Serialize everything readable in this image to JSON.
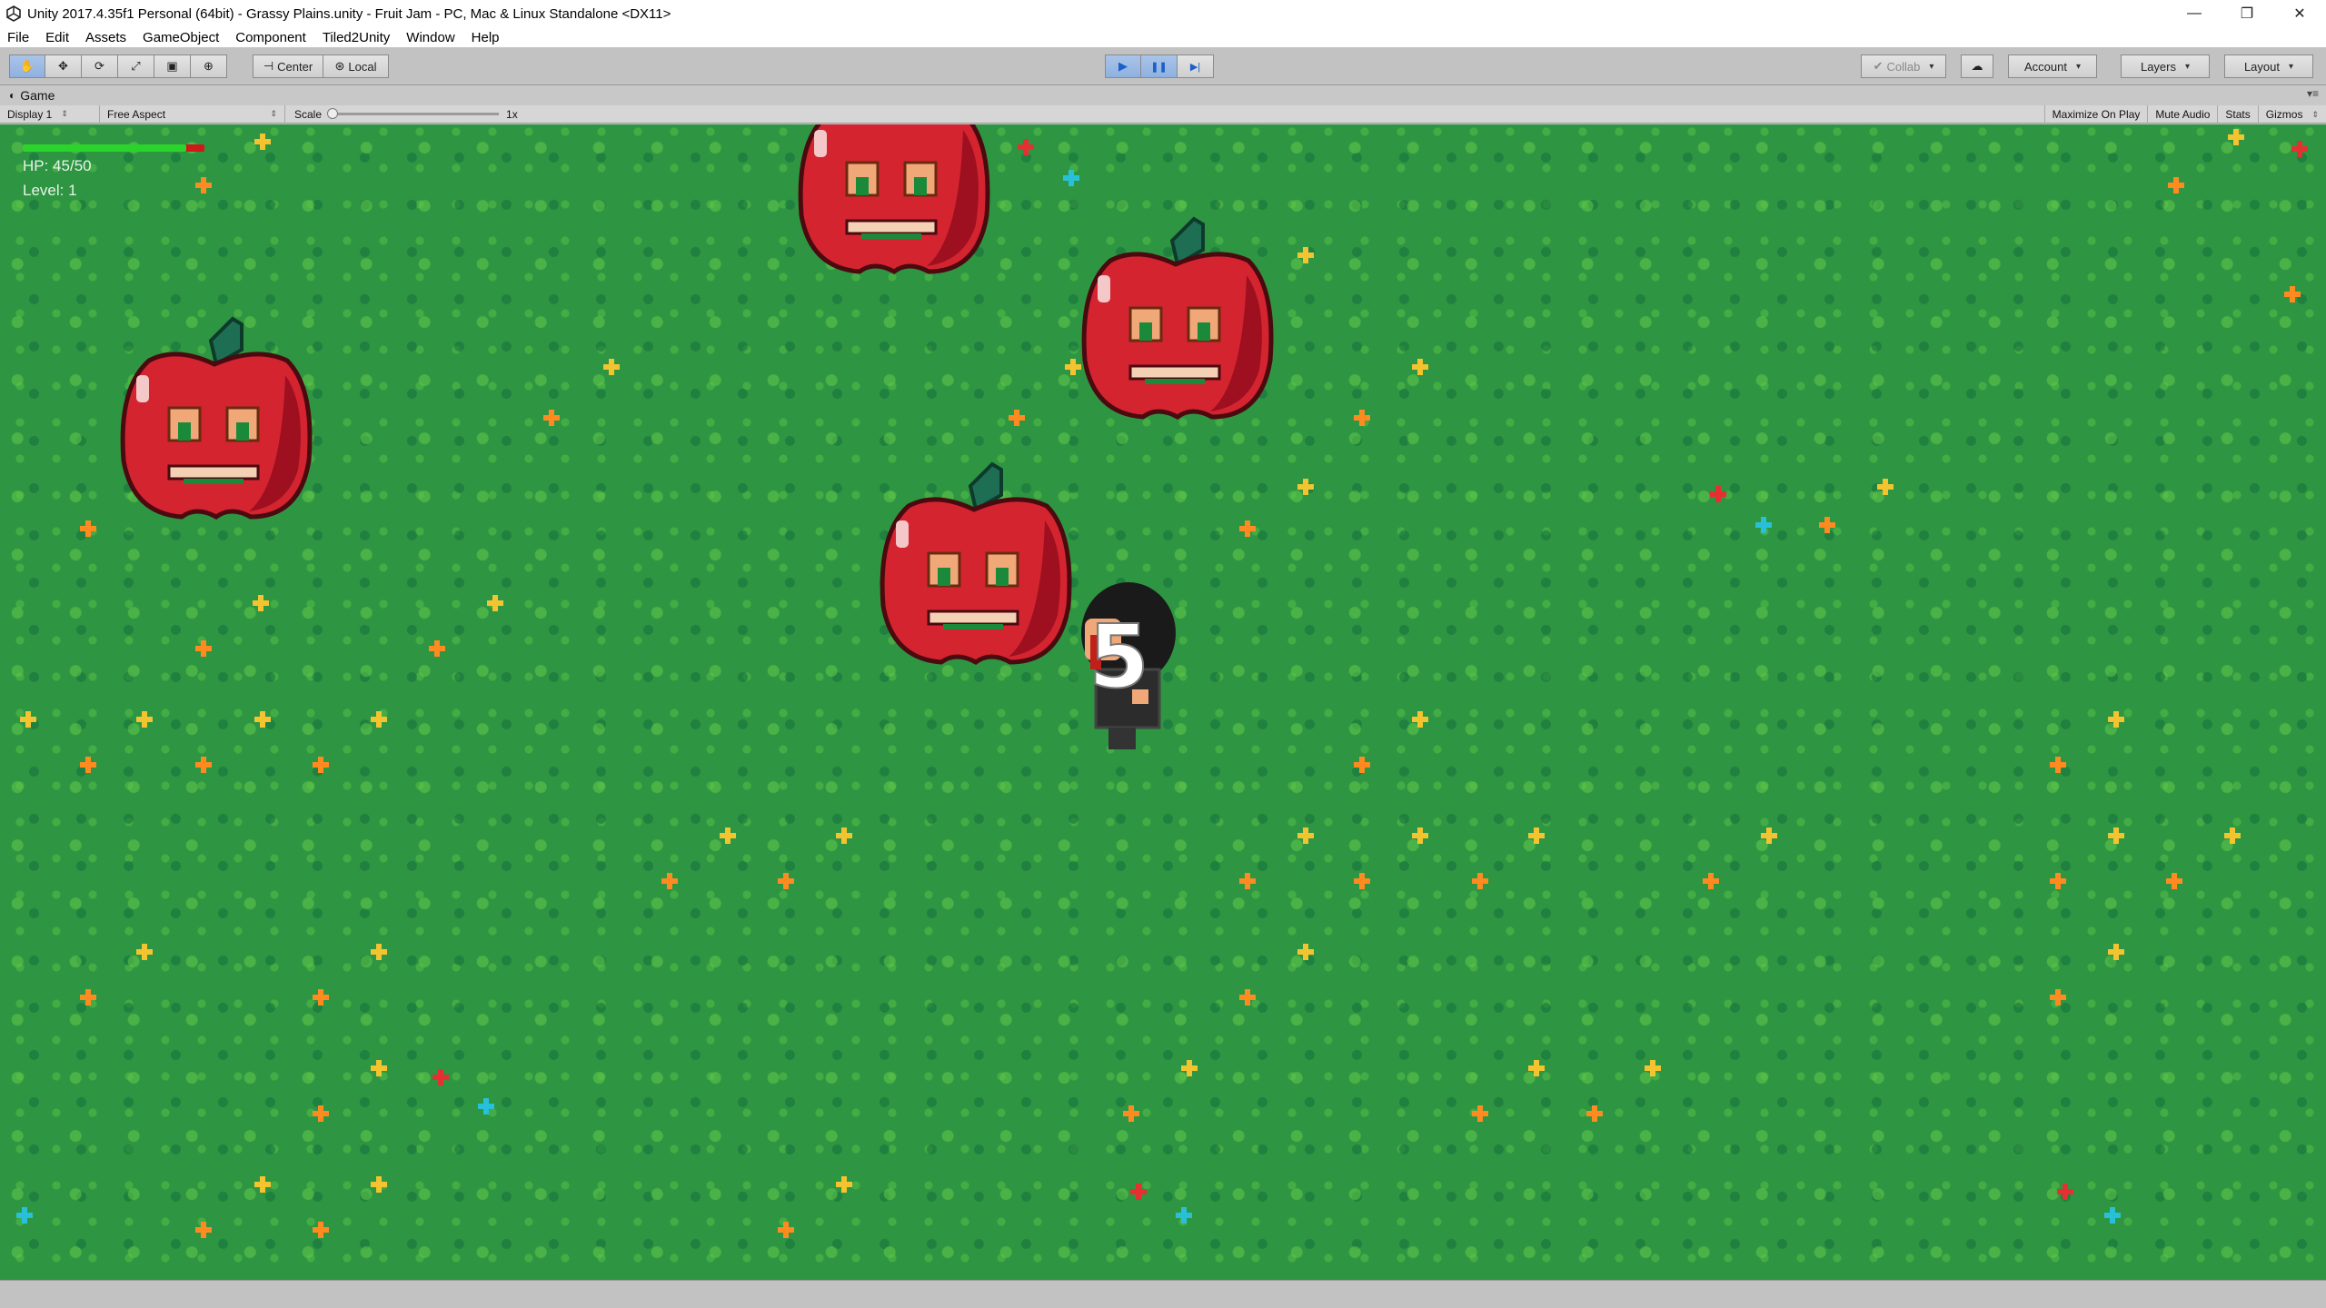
{
  "window": {
    "title": "Unity 2017.4.35f1 Personal (64bit) - Grassy Plains.unity - Fruit Jam - PC, Mac & Linux Standalone <DX11>",
    "controls": {
      "minimize": "—",
      "restore": "❐",
      "close": "✕"
    }
  },
  "menu": [
    "File",
    "Edit",
    "Assets",
    "GameObject",
    "Component",
    "Tiled2Unity",
    "Window",
    "Help"
  ],
  "toolbar": {
    "tools": [
      {
        "icon": "✋",
        "name": "hand-tool-button"
      },
      {
        "icon": "✥",
        "name": "move-tool-button"
      },
      {
        "icon": "⟳",
        "name": "rotate-tool-button"
      },
      {
        "icon": "⤢",
        "name": "scale-tool-button"
      },
      {
        "icon": "▣",
        "name": "rect-tool-button"
      },
      {
        "icon": "⊕",
        "name": "transform-tool-button"
      }
    ],
    "pivot_label": "Center",
    "space_label": "Local",
    "play_icon": "▶",
    "pause_icon": "❚❚",
    "step_icon": "▶|",
    "collab_label": "Collab",
    "cloud_icon": "☁",
    "account_label": "Account",
    "layers_label": "Layers",
    "layout_label": "Layout"
  },
  "game_panel": {
    "tab_label": "Game",
    "display_label": "Display 1",
    "aspect_label": "Free Aspect",
    "scale_label": "Scale",
    "scale_value": "1x",
    "scale_fraction": 0.0,
    "maximize_label": "Maximize On Play",
    "mute_label": "Mute Audio",
    "stats_label": "Stats",
    "gizmos_label": "Gizmos"
  },
  "hud": {
    "hp_text": "HP: 45/50",
    "hp_fraction": 0.9,
    "level_text": "Level: 1"
  },
  "damage_number": "5",
  "colors": {
    "grass": "#2e9642",
    "apple": "#d42430",
    "apple_dark": "#9e1020",
    "leaf": "#1e6e54",
    "hp_green": "#2ad42a",
    "hp_red": "#d01818",
    "play_active": "#8fb1df"
  }
}
